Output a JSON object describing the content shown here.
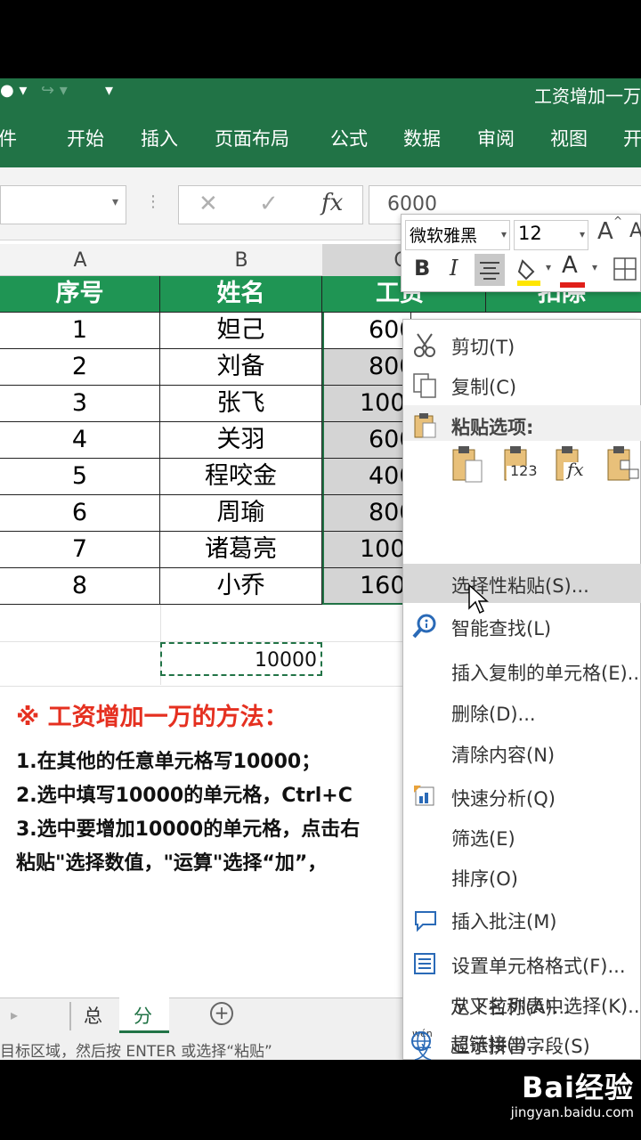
{
  "window": {
    "title": "工资增加一万"
  },
  "ribbon": {
    "tabs": [
      "件",
      "开始",
      "插入",
      "页面布局",
      "公式",
      "数据",
      "审阅",
      "视图",
      "开"
    ]
  },
  "formula_bar": {
    "cancel": "✕",
    "enter": "✓",
    "fx": "fx",
    "value": "6000"
  },
  "columns": [
    "A",
    "B",
    "C"
  ],
  "table": {
    "headers": [
      "序号",
      "姓名",
      "工资",
      "扣除"
    ],
    "rows": [
      [
        "1",
        "妲己",
        "600"
      ],
      [
        "2",
        "刘备",
        "800"
      ],
      [
        "3",
        "张飞",
        "100"
      ],
      [
        "4",
        "关羽",
        "600"
      ],
      [
        "5",
        "程咬金",
        "400"
      ],
      [
        "6",
        "周瑜",
        "800"
      ],
      [
        "7",
        "诸葛亮",
        "100"
      ],
      [
        "8",
        "小乔",
        "160"
      ]
    ],
    "copied_cell": "10000"
  },
  "note": {
    "title": "※ 工资增加一万的方法：",
    "lines": [
      "1.在其他的任意单元格写10000；",
      "2.选中填写10000的单元格，Ctrl+C",
      "3.选中要增加10000的单元格，点击右",
      "粘贴\"选择数值，\"运算\"选择“加”，"
    ]
  },
  "sheet_tabs": {
    "tabs": [
      "总",
      "分"
    ],
    "active": "分",
    "add": "+"
  },
  "status_bar": {
    "text": "目标区域，然后按 ENTER 或选择“粘贴”"
  },
  "mini_toolbar": {
    "font": "微软雅黑",
    "size": "12",
    "bold": "B",
    "italic": "I",
    "font_color": "A",
    "grow": "A"
  },
  "context_menu": {
    "items": [
      {
        "label": "剪切(T)",
        "icon": "scissors-icon"
      },
      {
        "label": "复制(C)",
        "icon": "copy-icon"
      },
      {
        "label": "粘贴选项:",
        "icon": "clipboard-icon"
      },
      {
        "label": "选择性粘贴(S)...",
        "icon": ""
      },
      {
        "label": "智能查找(L)",
        "icon": "smart-lookup-icon"
      },
      {
        "label": "插入复制的单元格(E)...",
        "icon": ""
      },
      {
        "label": "删除(D)...",
        "icon": ""
      },
      {
        "label": "清除内容(N)",
        "icon": ""
      },
      {
        "label": "快速分析(Q)",
        "icon": "quick-analysis-icon"
      },
      {
        "label": "筛选(E)",
        "icon": ""
      },
      {
        "label": "排序(O)",
        "icon": ""
      },
      {
        "label": "插入批注(M)",
        "icon": "comment-icon"
      },
      {
        "label": "设置单元格格式(F)...",
        "icon": "format-cells-icon"
      },
      {
        "label": "从下拉列表中选择(K)...",
        "icon": ""
      },
      {
        "label": "显示拼音字段(S)",
        "icon": "pinyin-icon"
      },
      {
        "label": "定义名称(A)...",
        "icon": ""
      },
      {
        "label": "超链接(I)...",
        "icon": "hyperlink-icon"
      }
    ],
    "paste_sub": [
      "",
      "123",
      "fx",
      ""
    ],
    "pinyin_icon_text": "wén"
  },
  "watermark": {
    "brand": "Bai经验",
    "url": "jingyan.baidu.com"
  },
  "colors": {
    "excel_green": "#217346",
    "header_green": "#1f9554",
    "note_red": "#e53020"
  }
}
